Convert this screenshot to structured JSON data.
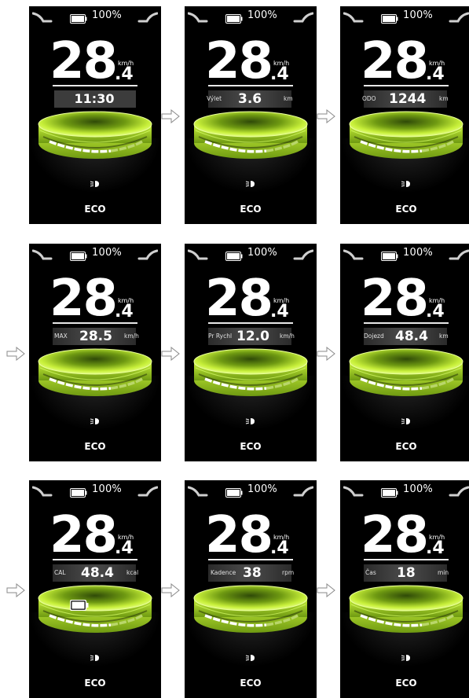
{
  "battery": {
    "percent_text": "100%",
    "level": 1.0
  },
  "speed": {
    "integer": "28",
    "decimal": ".4",
    "unit": "km/h"
  },
  "mode": "ECO",
  "icons": {
    "battery": "battery-icon",
    "light": "headlight-icon",
    "arrow": "arrow-right-icon"
  },
  "colors": {
    "accent": "#c8f03a",
    "accent_dark": "#6f9a12",
    "screen_bg": "#000000"
  },
  "screens": [
    {
      "label": "",
      "value": "11:30",
      "unit": "",
      "kind": "time"
    },
    {
      "label": "Výlet",
      "value": "3.6",
      "unit": "km",
      "kind": "field"
    },
    {
      "label": "ODO",
      "value": "1244",
      "unit": "km",
      "kind": "field"
    },
    {
      "label": "MAX",
      "value": "28.5",
      "unit": "km/h",
      "kind": "field"
    },
    {
      "label": "Pr Rychl",
      "value": "12.0",
      "unit": "km/h",
      "kind": "field"
    },
    {
      "label": "Dojezd",
      "value": "48.4",
      "unit": "km",
      "kind": "field"
    },
    {
      "label": "CAL",
      "value": "48.4",
      "unit": "kcal",
      "kind": "field"
    },
    {
      "label": "Kadence",
      "value": "38",
      "unit": "rpm",
      "kind": "field"
    },
    {
      "label": "Čas",
      "value": "18",
      "unit": "min",
      "kind": "field"
    }
  ]
}
